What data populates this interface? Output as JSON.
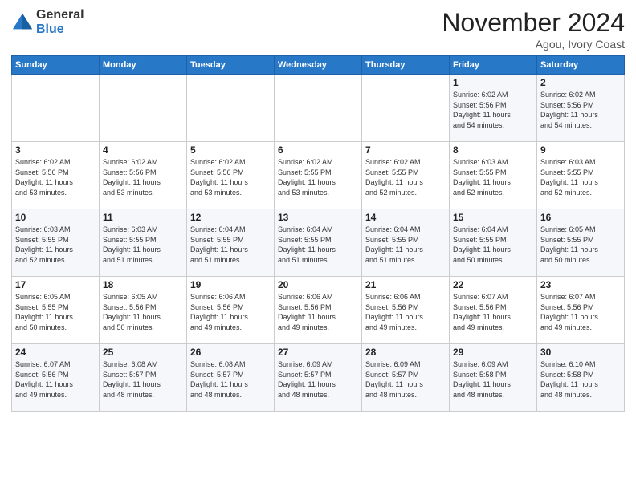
{
  "header": {
    "logo_general": "General",
    "logo_blue": "Blue",
    "month_title": "November 2024",
    "location": "Agou, Ivory Coast"
  },
  "weekdays": [
    "Sunday",
    "Monday",
    "Tuesday",
    "Wednesday",
    "Thursday",
    "Friday",
    "Saturday"
  ],
  "weeks": [
    [
      {
        "day": "",
        "info": ""
      },
      {
        "day": "",
        "info": ""
      },
      {
        "day": "",
        "info": ""
      },
      {
        "day": "",
        "info": ""
      },
      {
        "day": "",
        "info": ""
      },
      {
        "day": "1",
        "info": "Sunrise: 6:02 AM\nSunset: 5:56 PM\nDaylight: 11 hours\nand 54 minutes."
      },
      {
        "day": "2",
        "info": "Sunrise: 6:02 AM\nSunset: 5:56 PM\nDaylight: 11 hours\nand 54 minutes."
      }
    ],
    [
      {
        "day": "3",
        "info": "Sunrise: 6:02 AM\nSunset: 5:56 PM\nDaylight: 11 hours\nand 53 minutes."
      },
      {
        "day": "4",
        "info": "Sunrise: 6:02 AM\nSunset: 5:56 PM\nDaylight: 11 hours\nand 53 minutes."
      },
      {
        "day": "5",
        "info": "Sunrise: 6:02 AM\nSunset: 5:56 PM\nDaylight: 11 hours\nand 53 minutes."
      },
      {
        "day": "6",
        "info": "Sunrise: 6:02 AM\nSunset: 5:55 PM\nDaylight: 11 hours\nand 53 minutes."
      },
      {
        "day": "7",
        "info": "Sunrise: 6:02 AM\nSunset: 5:55 PM\nDaylight: 11 hours\nand 52 minutes."
      },
      {
        "day": "8",
        "info": "Sunrise: 6:03 AM\nSunset: 5:55 PM\nDaylight: 11 hours\nand 52 minutes."
      },
      {
        "day": "9",
        "info": "Sunrise: 6:03 AM\nSunset: 5:55 PM\nDaylight: 11 hours\nand 52 minutes."
      }
    ],
    [
      {
        "day": "10",
        "info": "Sunrise: 6:03 AM\nSunset: 5:55 PM\nDaylight: 11 hours\nand 52 minutes."
      },
      {
        "day": "11",
        "info": "Sunrise: 6:03 AM\nSunset: 5:55 PM\nDaylight: 11 hours\nand 51 minutes."
      },
      {
        "day": "12",
        "info": "Sunrise: 6:04 AM\nSunset: 5:55 PM\nDaylight: 11 hours\nand 51 minutes."
      },
      {
        "day": "13",
        "info": "Sunrise: 6:04 AM\nSunset: 5:55 PM\nDaylight: 11 hours\nand 51 minutes."
      },
      {
        "day": "14",
        "info": "Sunrise: 6:04 AM\nSunset: 5:55 PM\nDaylight: 11 hours\nand 51 minutes."
      },
      {
        "day": "15",
        "info": "Sunrise: 6:04 AM\nSunset: 5:55 PM\nDaylight: 11 hours\nand 50 minutes."
      },
      {
        "day": "16",
        "info": "Sunrise: 6:05 AM\nSunset: 5:55 PM\nDaylight: 11 hours\nand 50 minutes."
      }
    ],
    [
      {
        "day": "17",
        "info": "Sunrise: 6:05 AM\nSunset: 5:55 PM\nDaylight: 11 hours\nand 50 minutes."
      },
      {
        "day": "18",
        "info": "Sunrise: 6:05 AM\nSunset: 5:56 PM\nDaylight: 11 hours\nand 50 minutes."
      },
      {
        "day": "19",
        "info": "Sunrise: 6:06 AM\nSunset: 5:56 PM\nDaylight: 11 hours\nand 49 minutes."
      },
      {
        "day": "20",
        "info": "Sunrise: 6:06 AM\nSunset: 5:56 PM\nDaylight: 11 hours\nand 49 minutes."
      },
      {
        "day": "21",
        "info": "Sunrise: 6:06 AM\nSunset: 5:56 PM\nDaylight: 11 hours\nand 49 minutes."
      },
      {
        "day": "22",
        "info": "Sunrise: 6:07 AM\nSunset: 5:56 PM\nDaylight: 11 hours\nand 49 minutes."
      },
      {
        "day": "23",
        "info": "Sunrise: 6:07 AM\nSunset: 5:56 PM\nDaylight: 11 hours\nand 49 minutes."
      }
    ],
    [
      {
        "day": "24",
        "info": "Sunrise: 6:07 AM\nSunset: 5:56 PM\nDaylight: 11 hours\nand 49 minutes."
      },
      {
        "day": "25",
        "info": "Sunrise: 6:08 AM\nSunset: 5:57 PM\nDaylight: 11 hours\nand 48 minutes."
      },
      {
        "day": "26",
        "info": "Sunrise: 6:08 AM\nSunset: 5:57 PM\nDaylight: 11 hours\nand 48 minutes."
      },
      {
        "day": "27",
        "info": "Sunrise: 6:09 AM\nSunset: 5:57 PM\nDaylight: 11 hours\nand 48 minutes."
      },
      {
        "day": "28",
        "info": "Sunrise: 6:09 AM\nSunset: 5:57 PM\nDaylight: 11 hours\nand 48 minutes."
      },
      {
        "day": "29",
        "info": "Sunrise: 6:09 AM\nSunset: 5:58 PM\nDaylight: 11 hours\nand 48 minutes."
      },
      {
        "day": "30",
        "info": "Sunrise: 6:10 AM\nSunset: 5:58 PM\nDaylight: 11 hours\nand 48 minutes."
      }
    ]
  ]
}
